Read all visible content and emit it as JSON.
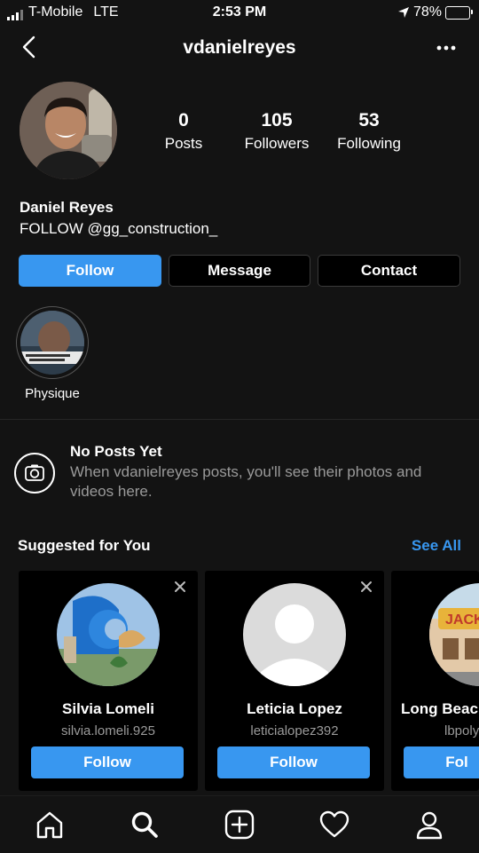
{
  "status_bar": {
    "carrier": "T-Mobile",
    "network": "LTE",
    "time": "2:53 PM",
    "battery_percent": "78%",
    "battery_level": 0.78
  },
  "header": {
    "username": "vdanielreyes",
    "back_icon": "chevron-left-icon",
    "more_icon": "ellipsis-icon"
  },
  "profile": {
    "posts_count": "0",
    "posts_label": "Posts",
    "followers_count": "105",
    "followers_label": "Followers",
    "following_count": "53",
    "following_label": "Following",
    "full_name": "Daniel Reyes",
    "bio": "FOLLOW @gg_construction_"
  },
  "actions": {
    "follow": "Follow",
    "message": "Message",
    "contact": "Contact",
    "follow_color": "#3897f0"
  },
  "highlights": [
    {
      "label": "Physique"
    }
  ],
  "empty_state": {
    "icon": "camera-icon",
    "title": "No Posts Yet",
    "text": "When vdanielreyes posts, you'll see their photos and videos here."
  },
  "suggested": {
    "title": "Suggested for You",
    "see_all": "See All",
    "cards": [
      {
        "name": "Silvia Lomeli",
        "username": "silvia.lomeli.925",
        "button": "Follow"
      },
      {
        "name": "Leticia Lopez",
        "username": "leticialopez392",
        "button": "Follow"
      },
      {
        "name": "Long Beac",
        "username": "lbpoly",
        "button": "Fol"
      }
    ]
  },
  "tab_bar": {
    "icons": [
      "home-icon",
      "search-icon",
      "new-post-icon",
      "activity-heart-icon",
      "profile-icon"
    ]
  }
}
